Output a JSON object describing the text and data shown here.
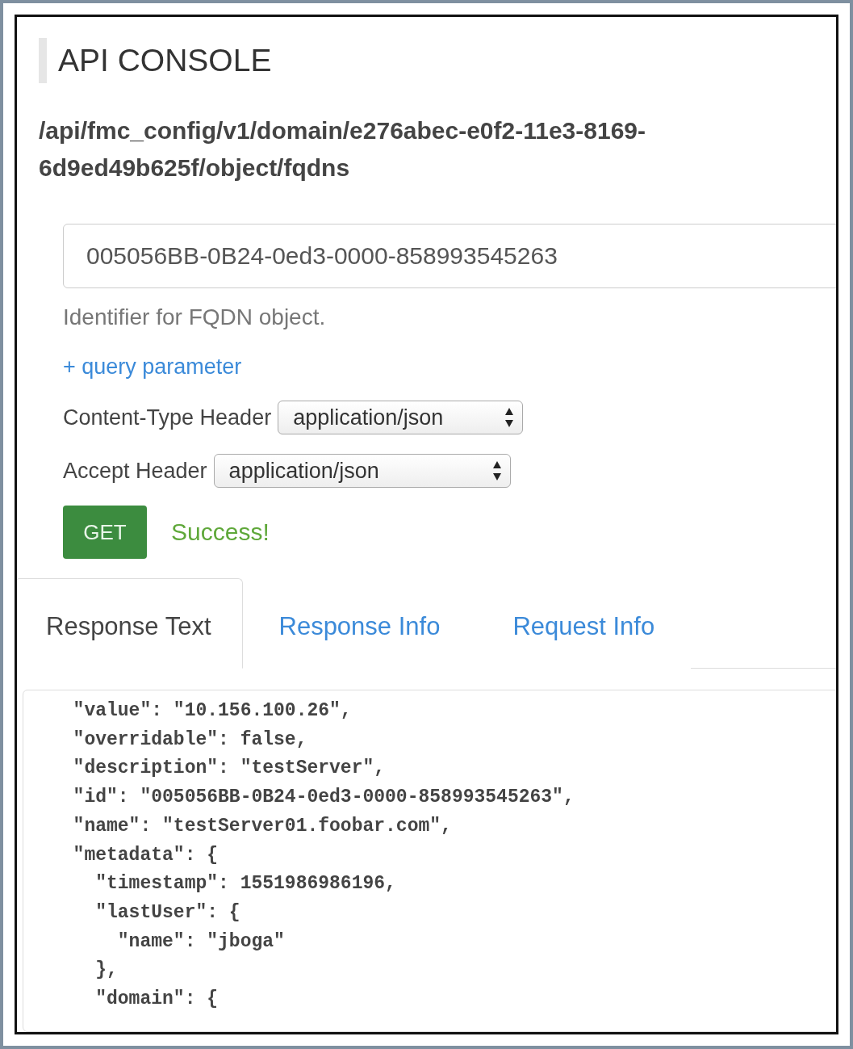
{
  "title": "API CONSOLE",
  "endpoint": "/api/fmc_config/v1/domain/e276abec-e0f2-11e3-8169-6d9ed49b625f/object/fqdns",
  "identifier_field": {
    "value": "005056BB-0B24-0ed3-0000-858993545263",
    "help": "Identifier for FQDN object."
  },
  "query_link": "+ query parameter",
  "headers": [
    {
      "label": "Content-Type Header",
      "value": "application/json"
    },
    {
      "label": "Accept Header",
      "value": "application/json"
    }
  ],
  "action": {
    "button": "GET",
    "status": "Success!"
  },
  "tabs": [
    {
      "label": "Response Text",
      "selected": true
    },
    {
      "label": "Response Info",
      "selected": false
    },
    {
      "label": "Request Info",
      "selected": false
    }
  ],
  "response_lines": [
    "  \"value\": \"10.156.100.26\",",
    "  \"overridable\": false,",
    "  \"description\": \"testServer\",",
    "  \"id\": \"005056BB-0B24-0ed3-0000-858993545263\",",
    "  \"name\": \"testServer01.foobar.com\",",
    "  \"metadata\": {",
    "    \"timestamp\": 1551986986196,",
    "    \"lastUser\": {",
    "      \"name\": \"jboga\"",
    "    },",
    "    \"domain\": {"
  ]
}
